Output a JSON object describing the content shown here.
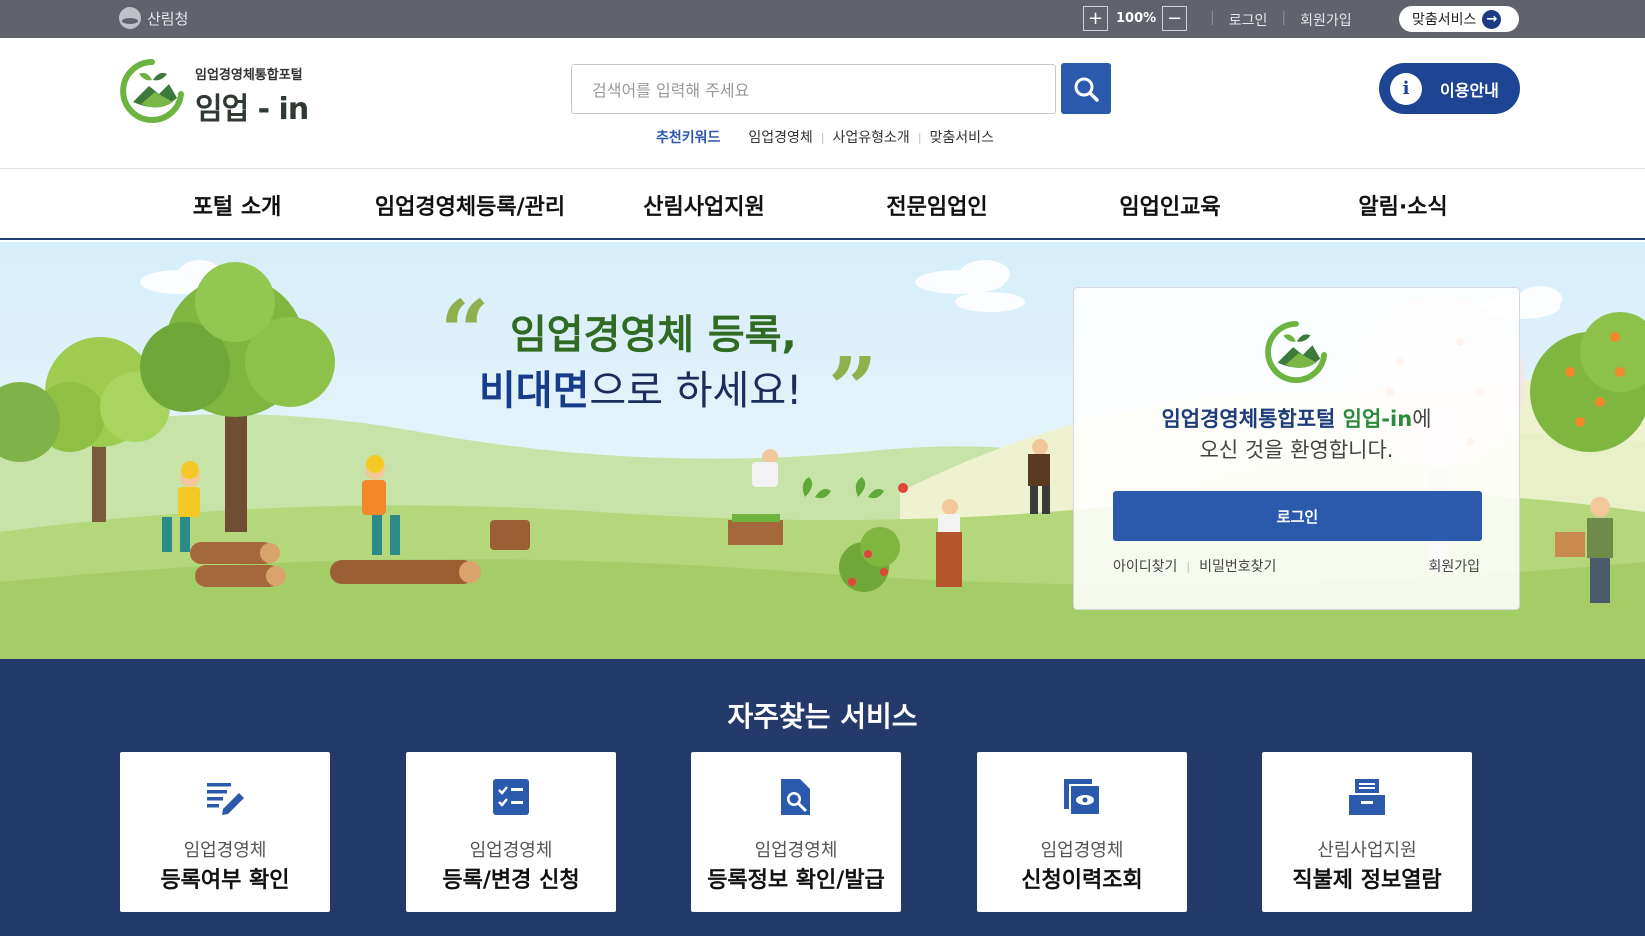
{
  "topbar": {
    "gov_name": "산림청",
    "zoom_in_icon": "plus-icon",
    "zoom_value": "100%",
    "zoom_out_icon": "minus-icon",
    "login": "로그인",
    "signup": "회원가입",
    "custom_service": "맞춤서비스"
  },
  "header": {
    "logo_subtitle": "임업경영체통합포털",
    "logo_title": "임업 - in",
    "search_placeholder": "검색어를 입력해 주세요",
    "keywords_title": "추천키워드",
    "keywords": [
      "임업경영체",
      "사업유형소개",
      "맞춤서비스"
    ],
    "guide_label": "이용안내",
    "guide_icon_glyph": "i"
  },
  "nav": {
    "items": [
      "포털 소개",
      "임업경영체등록/관리",
      "산림사업지원",
      "전문임업인",
      "임업인교육",
      "알림·소식"
    ]
  },
  "hero": {
    "line1": "임업경영체 등록,",
    "line2_bold": "비대면",
    "line2_rest": "으로 하세요!",
    "quote_open": "“",
    "quote_close": "”"
  },
  "login_card": {
    "welcome_portal": "임업경영체통합포털",
    "welcome_brand": "임업-in",
    "welcome_suffix": "에",
    "welcome_line2": "오신 것을 환영합니다.",
    "login_button": "로그인",
    "find_id": "아이디찾기",
    "find_pw": "비밀번호찾기",
    "signup": "회원가입"
  },
  "services": {
    "title": "자주찾는 서비스",
    "items": [
      {
        "sub": "임업경영체",
        "main": "등록여부 확인",
        "icon": "edit-document-icon"
      },
      {
        "sub": "임업경영체",
        "main": "등록/변경 신청",
        "icon": "checklist-icon"
      },
      {
        "sub": "임업경영체",
        "main": "등록정보 확인/발급",
        "icon": "document-search-icon"
      },
      {
        "sub": "임업경영체",
        "main": "신청이력조회",
        "icon": "view-history-icon"
      },
      {
        "sub": "산림사업지원",
        "main": "직불제 정보열람",
        "icon": "archive-box-icon"
      }
    ]
  },
  "colors": {
    "topbar": "#60626c",
    "primary": "#2b59ac",
    "navy": "#233a6b",
    "green": "#2f6b22"
  }
}
